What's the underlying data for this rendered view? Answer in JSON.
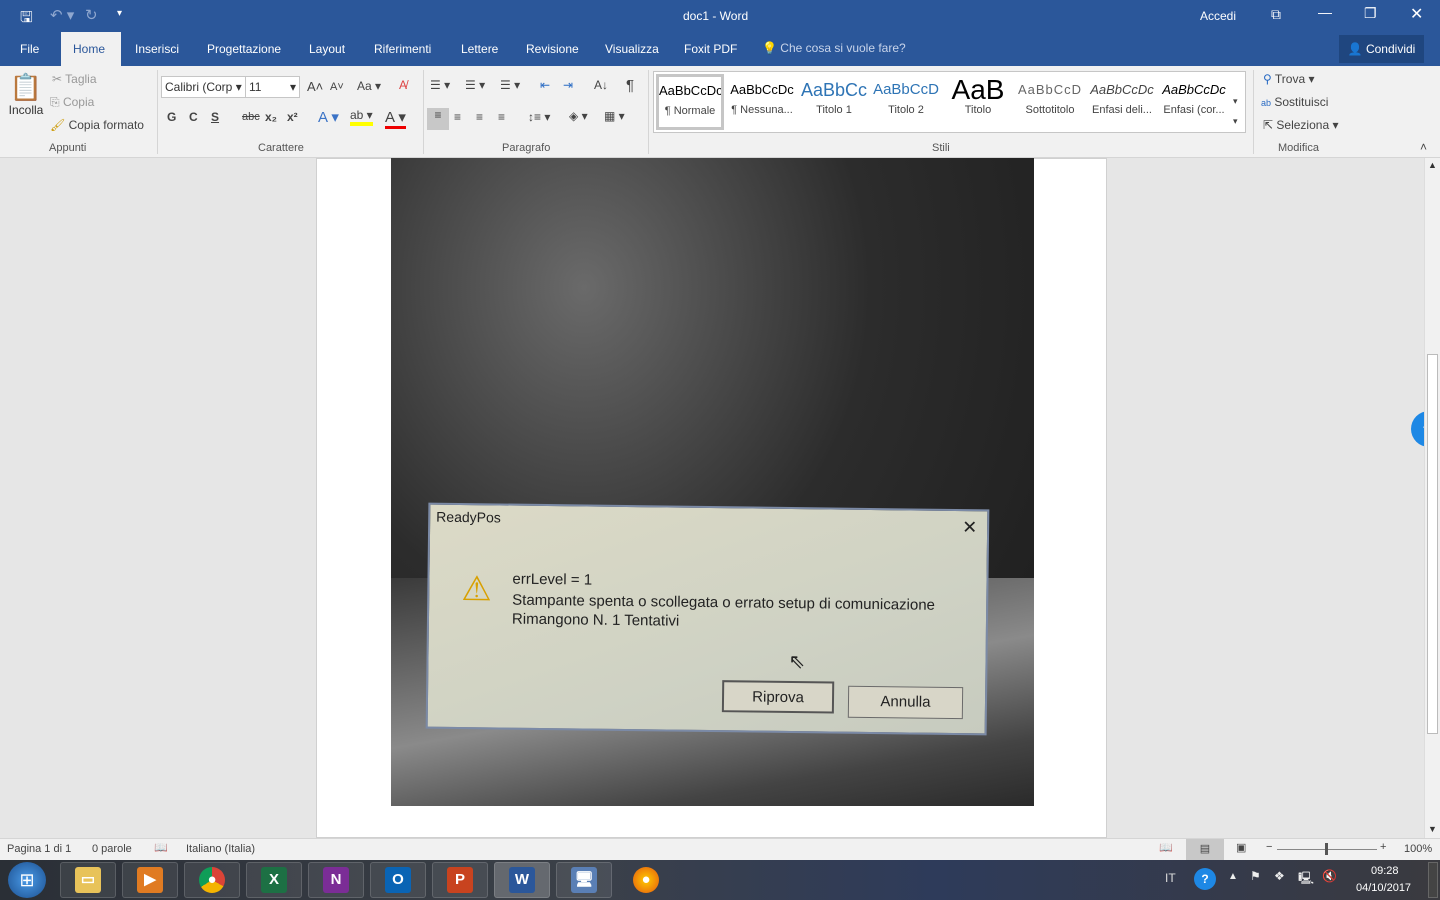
{
  "title": "doc1  -  Word",
  "account": "Accedi",
  "tabs": [
    "File",
    "Home",
    "Inserisci",
    "Progettazione",
    "Layout",
    "Riferimenti",
    "Lettere",
    "Revisione",
    "Visualizza",
    "Foxit PDF"
  ],
  "tell_me": "Che cosa si vuole fare?",
  "share": "Condividi",
  "clipboard": {
    "paste": "Incolla",
    "cut": "Taglia",
    "copy": "Copia",
    "format_painter": "Copia formato",
    "group": "Appunti"
  },
  "font": {
    "name": "Calibri (Corp",
    "size": "11",
    "change_case": "Aa",
    "bold": "G",
    "italic": "C",
    "underline": "S",
    "strike": "abc",
    "group": "Carattere"
  },
  "paragraph": {
    "group": "Paragrafo"
  },
  "styles": {
    "group": "Stili",
    "items": [
      {
        "preview": "AaBbCcDc",
        "label": "¶ Normale"
      },
      {
        "preview": "AaBbCcDc",
        "label": "¶ Nessuna..."
      },
      {
        "preview": "AaBbCc",
        "label": "Titolo 1"
      },
      {
        "preview": "AaBbCcD",
        "label": "Titolo 2"
      },
      {
        "preview": "AaB",
        "label": "Titolo"
      },
      {
        "preview": "AaBbCcD",
        "label": "Sottotitolo"
      },
      {
        "preview": "AaBbCcDc",
        "label": "Enfasi deli..."
      },
      {
        "preview": "AaBbCcDc",
        "label": "Enfasi (cor..."
      }
    ]
  },
  "editing": {
    "find": "Trova",
    "replace": "Sostituisci",
    "select": "Seleziona",
    "group": "Modifica"
  },
  "photo_dialog": {
    "title": "ReadyPos",
    "line1": "errLevel = 1",
    "line2": "Stampante spenta o scollegata o errato setup di comunicazione",
    "line3": "Rimangono N. 1 Tentativi",
    "retry": "Riprova",
    "cancel": "Annulla"
  },
  "status": {
    "page": "Pagina 1 di 1",
    "words": "0 parole",
    "language": "Italiano (Italia)",
    "zoom": "100%",
    "zoom_percent": 100
  },
  "taskbar": {
    "lang": "IT",
    "time": "09:28",
    "date": "04/10/2017"
  }
}
